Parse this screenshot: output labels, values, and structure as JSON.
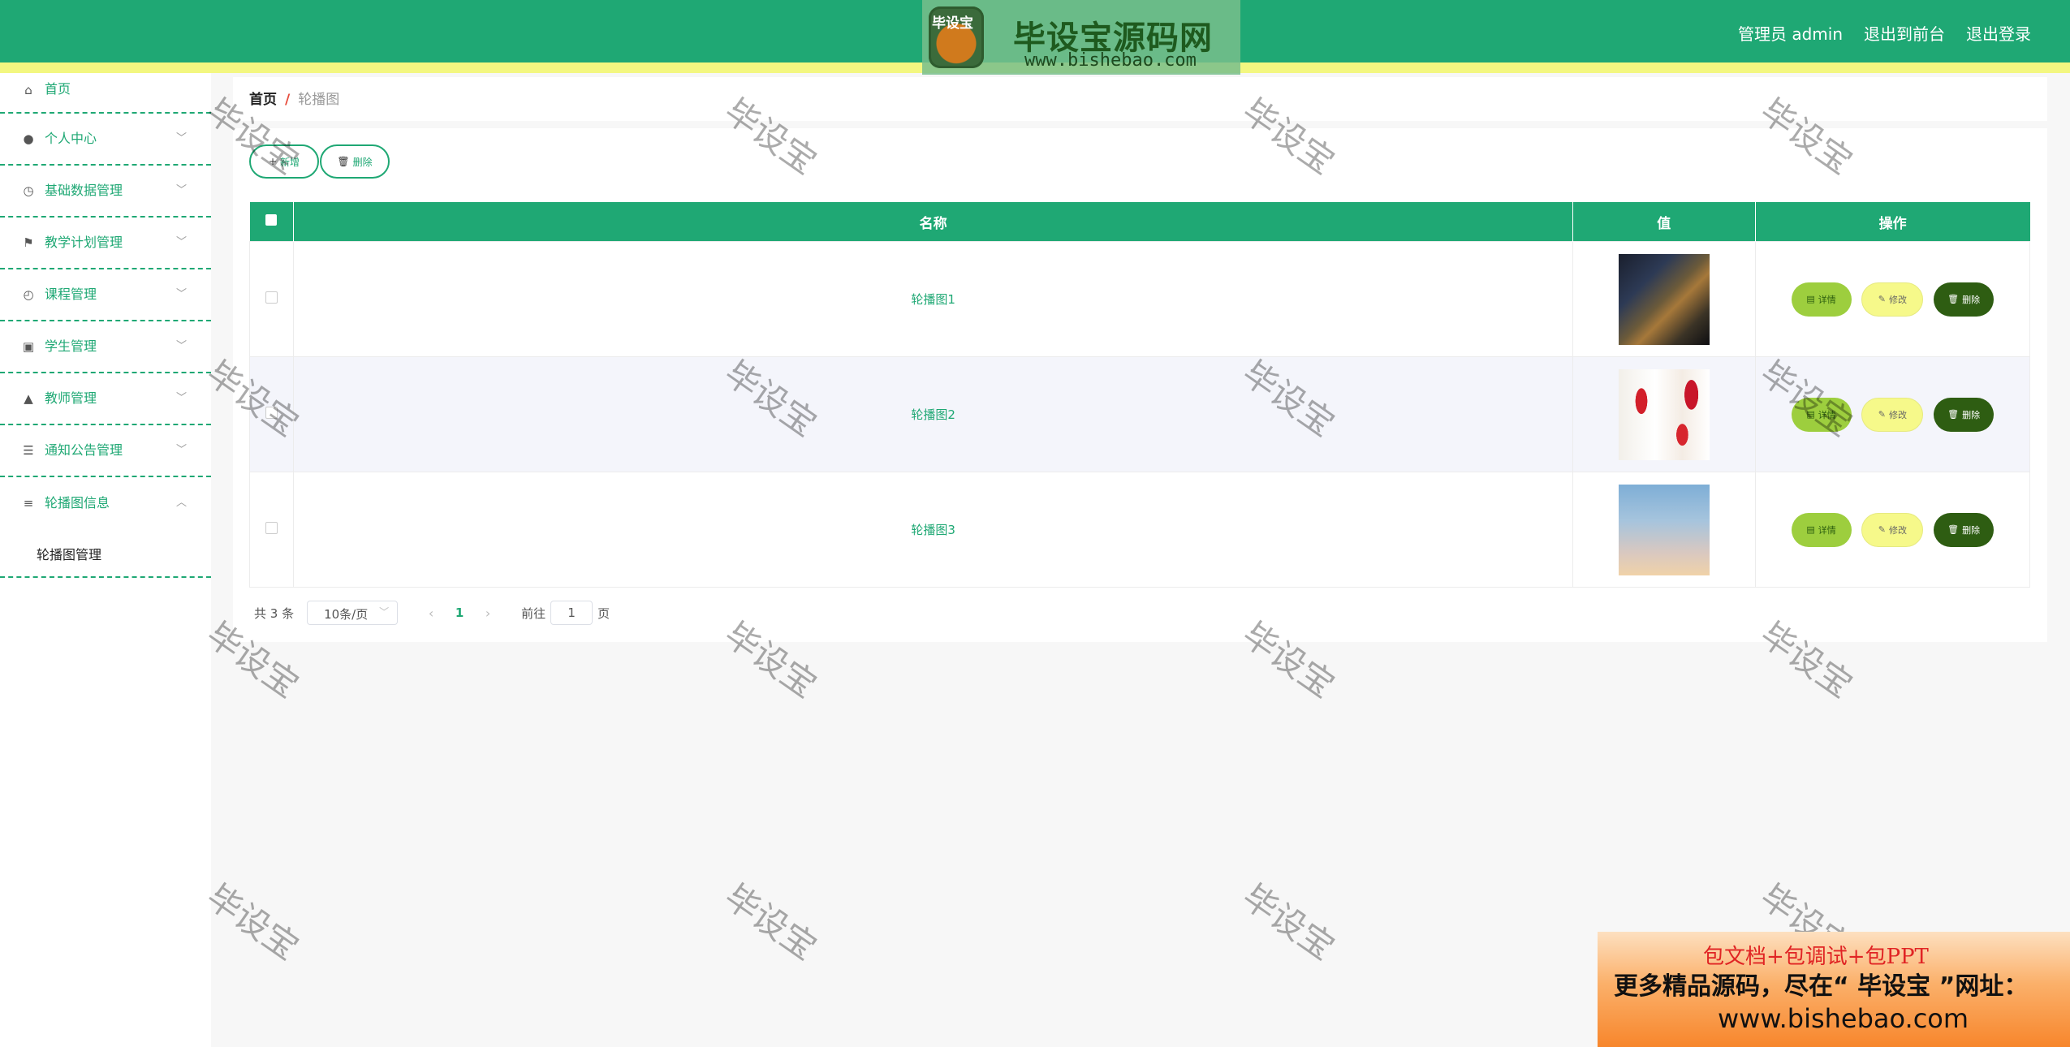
{
  "header": {
    "logo_badge": "毕设宝",
    "logo_title": "毕设宝源码网",
    "logo_url": "www.bishebao.com",
    "user": "管理员 admin",
    "front_link": "退出到前台",
    "logout_link": "退出登录",
    "colors": {
      "primary": "#1fa874",
      "strip": "#f3f780"
    }
  },
  "sidebar": {
    "items": [
      {
        "label": "首页",
        "icon": "home-icon"
      },
      {
        "label": "个人中心",
        "icon": "user-icon"
      },
      {
        "label": "基础数据管理",
        "icon": "clock-icon"
      },
      {
        "label": "教学计划管理",
        "icon": "flag-icon"
      },
      {
        "label": "课程管理",
        "icon": "compass-icon"
      },
      {
        "label": "学生管理",
        "icon": "clipboard-icon"
      },
      {
        "label": "教师管理",
        "icon": "stamp-icon"
      },
      {
        "label": "通知公告管理",
        "icon": "sliders-icon"
      },
      {
        "label": "轮播图信息",
        "icon": "menu-icon"
      }
    ],
    "submenu": {
      "label": "轮播图管理"
    }
  },
  "breadcrumb": {
    "home": "首页",
    "separator": "/",
    "current": "轮播图"
  },
  "toolbar": {
    "add_label": "新增",
    "delete_label": "删除"
  },
  "table": {
    "headers": {
      "name": "名称",
      "value": "值",
      "ops": "操作"
    },
    "rows": [
      {
        "name": "轮播图1",
        "image": "dark-blurred-lights-thumbnail"
      },
      {
        "name": "轮播图2",
        "image": "red-tulips-thumbnail"
      },
      {
        "name": "轮播图3",
        "image": "pastel-sky-thumbnail"
      }
    ],
    "row_actions": {
      "detail": "详情",
      "edit": "修改",
      "remove": "删除"
    }
  },
  "pagination": {
    "total": "共 3 条",
    "page_size": "10条/页",
    "current_page": "1",
    "goto_label": "前往",
    "goto_value": "1",
    "page_suffix": "页"
  },
  "watermark": "毕设宝",
  "ad": {
    "line1": "包文档+包调试+包PPT",
    "line2": "更多精品源码，尽在“ 毕设宝 ”网址：",
    "line3": "www.bishebao.com"
  }
}
